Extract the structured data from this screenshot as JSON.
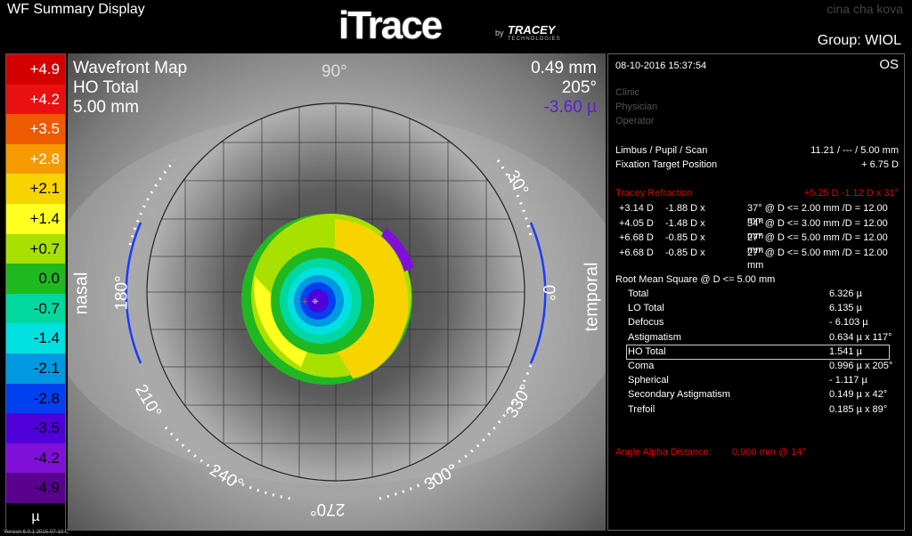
{
  "app": {
    "title": "WF Summary Display",
    "group_label": "Group:  WIOL",
    "top_right": "cina  cha  kova",
    "version": "Version 6.0.1 2015-07-10 C"
  },
  "logo": {
    "main": "iTrace",
    "by": "by",
    "brand": "TRACEY",
    "sub": "TECHNOLOGIES"
  },
  "scale": {
    "unit": "µ",
    "items": [
      {
        "label": "+4.9",
        "color": "#d40000",
        "text": "#ffffff"
      },
      {
        "label": "+4.2",
        "color": "#e81010",
        "text": "#ffffff"
      },
      {
        "label": "+3.5",
        "color": "#ee5a00",
        "text": "#ffffff"
      },
      {
        "label": "+2.8",
        "color": "#f59a00",
        "text": "#ffffff"
      },
      {
        "label": "+2.1",
        "color": "#f7d400",
        "text": "#000000"
      },
      {
        "label": "+1.4",
        "color": "#ffff20",
        "text": "#000000"
      },
      {
        "label": "+0.7",
        "color": "#a8e000",
        "text": "#000000"
      },
      {
        "label": "0.0",
        "color": "#20b820",
        "text": "#000000"
      },
      {
        "label": "-0.7",
        "color": "#00d8a0",
        "text": "#000000"
      },
      {
        "label": "-1.4",
        "color": "#00e0e0",
        "text": "#000000"
      },
      {
        "label": "-2.1",
        "color": "#0098e0",
        "text": "#000000"
      },
      {
        "label": "-2.8",
        "color": "#0040f0",
        "text": "#000000"
      },
      {
        "label": "-3.5",
        "color": "#5000d8",
        "text": "#000000"
      },
      {
        "label": "-4.2",
        "color": "#8010d8",
        "text": "#000000"
      },
      {
        "label": "-4.9",
        "color": "#5a0090",
        "text": "#000000"
      }
    ]
  },
  "map": {
    "title": "Wavefront Map",
    "type": "HO Total",
    "diameter": "5.00 mm",
    "right_value1": "0.49 mm",
    "right_value2": "205°",
    "right_value3": "-3.60 µ",
    "angle_90": "90°",
    "angle_0": "0°",
    "angle_180": "180°",
    "angle_30": "30°",
    "angle_210": "210°",
    "angle_240": "240°",
    "angle_270": "270°",
    "angle_300": "300°",
    "angle_330": "330°",
    "nasal": "nasal",
    "temporal": "temporal"
  },
  "panel": {
    "date": "08-10-2016  15:37:54",
    "eye": "OS",
    "clinic": "Clinic",
    "physician": "Physician",
    "operator": "Operator",
    "limbus_label": "Limbus / Pupil / Scan",
    "limbus_value": "11.21 / --- / 5.00 mm",
    "fixation_label": "Fixation Target Position",
    "fixation_value": "+ 6.75 D",
    "refraction_label": "Tracey Refraction",
    "refraction_value": "+5.25 D -1.12 D x 31°",
    "refractions": [
      {
        "sph": "+3.14 D",
        "cyl": "-1.88 D x",
        "axis": "37° @ D <= 2.00 mm /D = 12.00 mm"
      },
      {
        "sph": "+4.05 D",
        "cyl": "-1.48 D x",
        "axis": "34° @ D <= 3.00 mm /D = 12.00 mm"
      },
      {
        "sph": "+6.68 D",
        "cyl": "-0.85 D x",
        "axis": "27° @ D <= 5.00 mm /D = 12.00 mm"
      },
      {
        "sph": "+6.68 D",
        "cyl": "-0.85 D x",
        "axis": "27° @ D <= 5.00 mm /D = 12.00 mm"
      }
    ],
    "rms_title": "Root Mean Square @ D <= 5.00 mm",
    "rms": [
      {
        "label": "Total",
        "value": "6.326 µ"
      },
      {
        "label": "LO Total",
        "value": "6.135 µ"
      },
      {
        "label": "Defocus",
        "value": "- 6.103 µ"
      },
      {
        "label": "Astigmatism",
        "value": "0.634 µ x 117°"
      },
      {
        "label": "HO Total",
        "value": "1.541 µ"
      },
      {
        "label": "Coma",
        "value": "0.996 µ x 205°"
      },
      {
        "label": "Spherical",
        "value": "- 1.117 µ"
      },
      {
        "label": "Secondary Astigmatism",
        "value": "0.149 µ x  42°"
      },
      {
        "label": "Trefoil",
        "value": "0.185 µ x  89°"
      }
    ],
    "angle_alpha_label": "Angle Alpha Distance:",
    "angle_alpha_value": "0.960 mm @ 14°"
  }
}
